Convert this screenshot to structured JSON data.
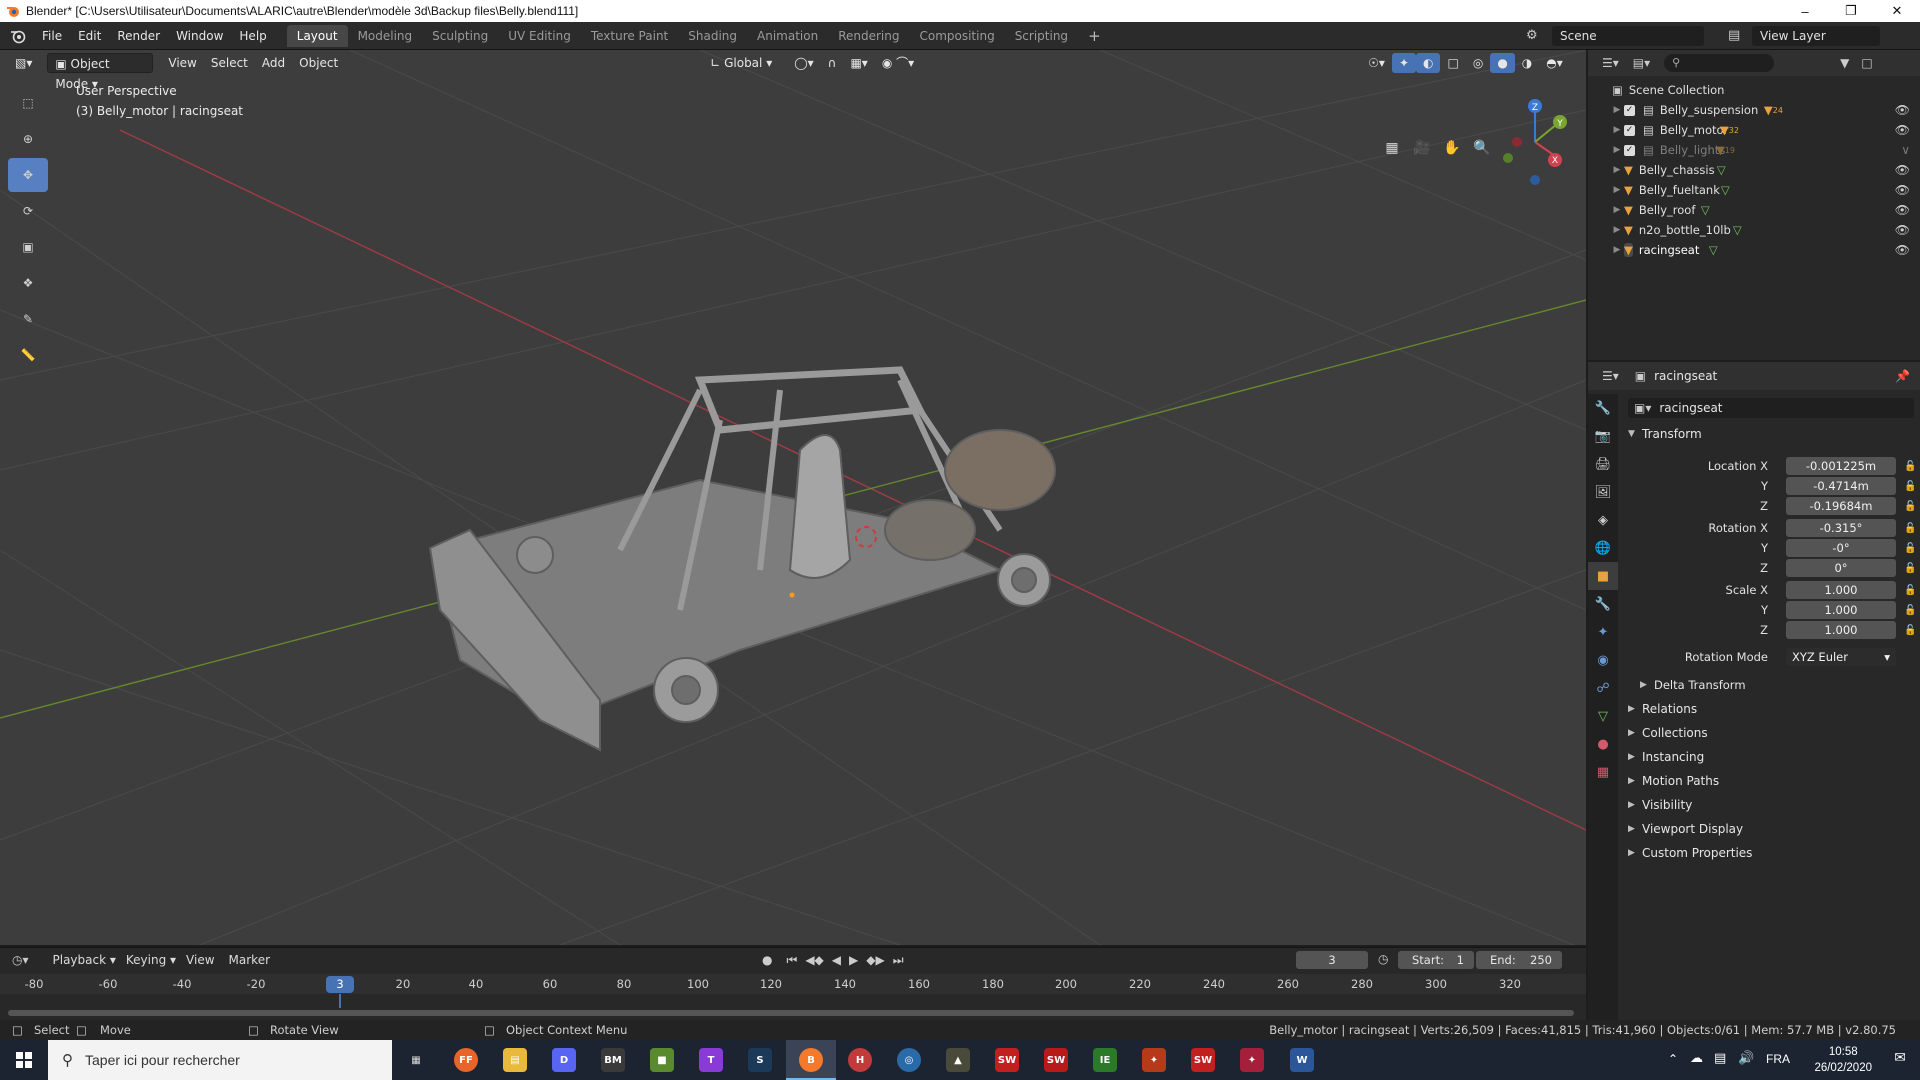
{
  "window": {
    "title": "Blender* [C:\\Users\\Utilisateur\\Documents\\ALARIC\\autre\\Blender\\modèle 3d\\Backup files\\Belly.blend111]"
  },
  "menu": [
    "File",
    "Edit",
    "Render",
    "Window",
    "Help"
  ],
  "workspaces": [
    {
      "label": "Layout",
      "active": true
    },
    {
      "label": "Modeling"
    },
    {
      "label": "Sculpting"
    },
    {
      "label": "UV Editing"
    },
    {
      "label": "Texture Paint"
    },
    {
      "label": "Shading"
    },
    {
      "label": "Animation"
    },
    {
      "label": "Rendering"
    },
    {
      "label": "Compositing"
    },
    {
      "label": "Scripting"
    }
  ],
  "scene": "Scene",
  "view_layer": "View Layer",
  "viewport": {
    "mode": "Object Mode",
    "menus": [
      "View",
      "Select",
      "Add",
      "Object"
    ],
    "transform_orientation": "Global",
    "perspective_label": "User Perspective",
    "selection_label": "(3) Belly_motor | racingseat",
    "gizmo": {
      "x": "X",
      "y": "Y",
      "z": "Z"
    }
  },
  "outliner": {
    "root": "Scene Collection",
    "items": [
      {
        "label": "Belly_suspension",
        "type": "collection",
        "badge": "24"
      },
      {
        "label": "Belly_motor",
        "type": "collection",
        "badge": "32"
      },
      {
        "label": "Belly_lights",
        "type": "collection",
        "badge": "19",
        "disabled": true
      },
      {
        "label": "Belly_chassis",
        "type": "object"
      },
      {
        "label": "Belly_fueltank",
        "type": "object"
      },
      {
        "label": "Belly_roof",
        "type": "object"
      },
      {
        "label": "n2o_bottle_10lb",
        "type": "object"
      },
      {
        "label": "racingseat",
        "type": "object"
      }
    ]
  },
  "properties": {
    "header_object": "racingseat",
    "object_name": "racingseat",
    "transform_title": "Transform",
    "location_label": "Location X",
    "location": [
      "-0.001225m",
      "-0.4714m",
      "-0.19684m"
    ],
    "rotation_label": "Rotation X",
    "rotation": [
      "-0.315°",
      "-0°",
      "0°"
    ],
    "scale_label": "Scale X",
    "scale": [
      "1.000",
      "1.000",
      "1.000"
    ],
    "axis_y": "Y",
    "axis_z": "Z",
    "rotation_mode_label": "Rotation Mode",
    "rotation_mode": "XYZ Euler",
    "delta_transform": "Delta Transform",
    "sections": [
      "Relations",
      "Collections",
      "Instancing",
      "Motion Paths",
      "Visibility",
      "Viewport Display",
      "Custom Properties"
    ]
  },
  "timeline": {
    "menus": [
      "Playback",
      "Keying",
      "View",
      "Marker"
    ],
    "current_frame": "3",
    "start_label": "Start:",
    "start": "1",
    "end_label": "End:",
    "end": "250",
    "ruler": [
      "-80",
      "-60",
      "-40",
      "-20",
      "20",
      "40",
      "60",
      "80",
      "100",
      "120",
      "140",
      "160",
      "180",
      "200",
      "220",
      "240",
      "260",
      "280",
      "300",
      "320"
    ]
  },
  "status": {
    "select": "Select",
    "move": "Move",
    "rotate": "Rotate View",
    "context": "Object Context Menu",
    "stats": "Belly_motor | racingseat | Verts:26,509 | Faces:41,815 | Tris:41,960 | Objects:0/61 | Mem: 57.7 MB | v2.80.75"
  },
  "taskbar": {
    "search_placeholder": "Taper ici pour rechercher",
    "language": "FRA",
    "time": "10:58",
    "date": "26/02/2020"
  },
  "colors": {
    "accent": "#4772b3",
    "viewport_bg": "#3d3d3d",
    "axis_x": "#c0404d",
    "axis_y": "#6c9a2a",
    "object_orange": "#e8a33c",
    "mesh_green": "#6fc25a"
  }
}
